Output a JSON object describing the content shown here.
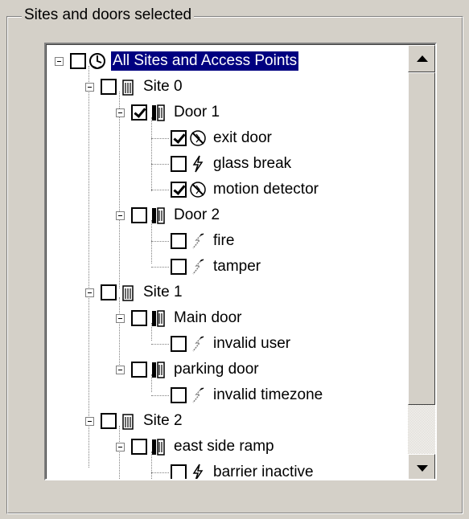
{
  "groupbox": {
    "title": "Sites and doors selected"
  },
  "tree": {
    "nodes": [
      {
        "label": "All Sites and Access Points",
        "icon": "globe-clock-icon",
        "checked": false,
        "selected": true
      },
      {
        "label": "Site 0",
        "icon": "building-icon",
        "checked": false
      },
      {
        "label": "Door 1",
        "icon": "door-icon",
        "checked": true
      },
      {
        "label": "exit door",
        "icon": "sensor-disabled-icon",
        "checked": true
      },
      {
        "label": "glass break",
        "icon": "lightning-icon",
        "checked": false
      },
      {
        "label": "motion detector",
        "icon": "sensor-disabled-icon",
        "checked": true
      },
      {
        "label": "Door 2",
        "icon": "door-icon",
        "checked": false
      },
      {
        "label": "fire",
        "icon": "lightning-faded-icon",
        "checked": false
      },
      {
        "label": "tamper",
        "icon": "lightning-faded-icon",
        "checked": false
      },
      {
        "label": "Site 1",
        "icon": "building-icon",
        "checked": false
      },
      {
        "label": "Main door",
        "icon": "door-icon",
        "checked": false
      },
      {
        "label": "invalid user",
        "icon": "lightning-faded-icon",
        "checked": false
      },
      {
        "label": "parking door",
        "icon": "door-icon",
        "checked": false
      },
      {
        "label": "invalid timezone",
        "icon": "lightning-faded-icon",
        "checked": false
      },
      {
        "label": "Site 2",
        "icon": "building-icon",
        "checked": false
      },
      {
        "label": "east side ramp",
        "icon": "door-icon",
        "checked": false
      },
      {
        "label": "barrier inactive",
        "icon": "lightning-icon",
        "checked": false
      }
    ]
  },
  "scrollbar": {
    "up_icon": "arrow-up-icon",
    "down_icon": "arrow-down-icon"
  }
}
